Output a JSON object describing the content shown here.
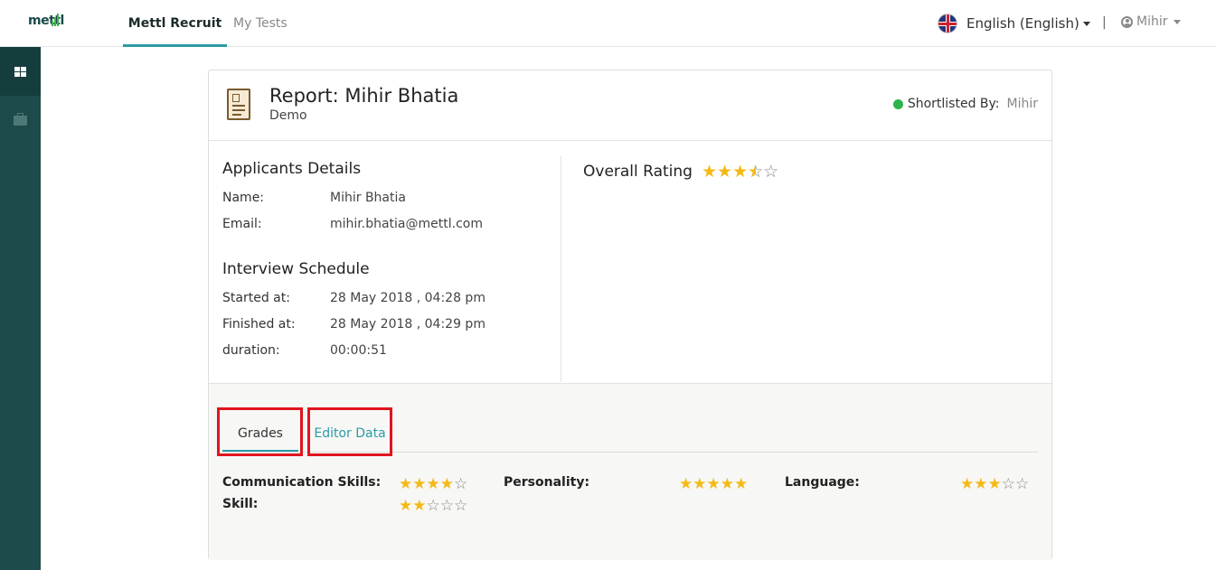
{
  "app": {
    "logo_text": "mettl",
    "nav_active": "Mettl Recruit",
    "nav_inactive": "My Tests",
    "language": "English (English)",
    "separator": "|",
    "user_name": "Mihir",
    "colors": {
      "accent": "#2a9ba6",
      "sidebar": "#1d4a4a",
      "star": "#f5b915",
      "highlight": "#e0141e",
      "status_green": "#2db34a"
    }
  },
  "sidebar": {
    "items": [
      {
        "icon": "dashboard-grid-icon",
        "active": true
      },
      {
        "icon": "briefcase-icon",
        "active": false
      }
    ]
  },
  "report": {
    "title_label": "Report:",
    "candidate": "Mihir Bhatia",
    "subtitle": "Demo",
    "shortlisted_label": "Shortlisted By:",
    "shortlisted_by": "Mihir"
  },
  "applicant": {
    "heading": "Applicants Details",
    "name_label": "Name:",
    "name_value": "Mihir Bhatia",
    "email_label": "Email:",
    "email_value": "mihir.bhatia@mettl.com"
  },
  "schedule": {
    "heading": "Interview Schedule",
    "started_label": "Started at:",
    "started_value": "28 May 2018 , 04:28 pm",
    "finished_label": "Finished at:",
    "finished_value": "28 May 2018 , 04:29 pm",
    "duration_label": "duration:",
    "duration_value": "00:00:51"
  },
  "overall": {
    "label": "Overall Rating",
    "rating": 3.5,
    "max": 5
  },
  "tabs": [
    {
      "label": "Grades",
      "active": true
    },
    {
      "label": "Editor Data",
      "active": false
    }
  ],
  "grades": [
    {
      "label": "Communication Skills:",
      "rating": 4,
      "max": 5
    },
    {
      "label": "Personality:",
      "rating": 5,
      "max": 5
    },
    {
      "label": "Language:",
      "rating": 3,
      "max": 5
    },
    {
      "label": "Skill:",
      "rating": 2,
      "max": 5
    }
  ]
}
